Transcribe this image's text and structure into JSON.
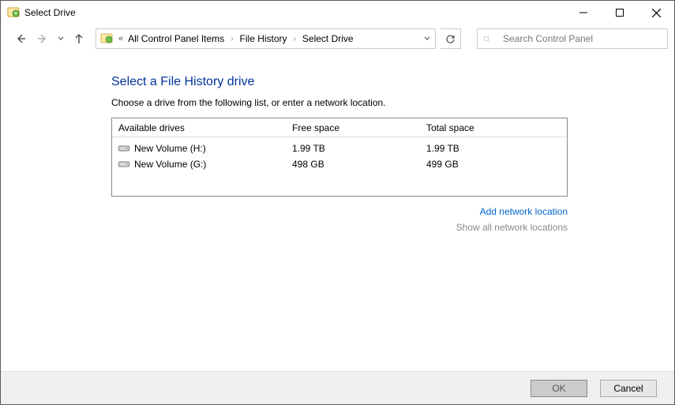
{
  "window": {
    "title": "Select Drive"
  },
  "breadcrumb": {
    "items": [
      "All Control Panel Items",
      "File History",
      "Select Drive"
    ]
  },
  "search": {
    "placeholder": "Search Control Panel"
  },
  "page": {
    "title": "Select a File History drive",
    "instruction": "Choose a drive from the following list, or enter a network location."
  },
  "table": {
    "headers": {
      "drives": "Available drives",
      "free": "Free space",
      "total": "Total space"
    },
    "rows": [
      {
        "name": "New Volume (H:)",
        "free": "1.99 TB",
        "total": "1.99 TB"
      },
      {
        "name": "New Volume (G:)",
        "free": "498 GB",
        "total": "499 GB"
      }
    ]
  },
  "links": {
    "add": "Add network location",
    "show": "Show all network locations"
  },
  "buttons": {
    "ok": "OK",
    "cancel": "Cancel"
  }
}
